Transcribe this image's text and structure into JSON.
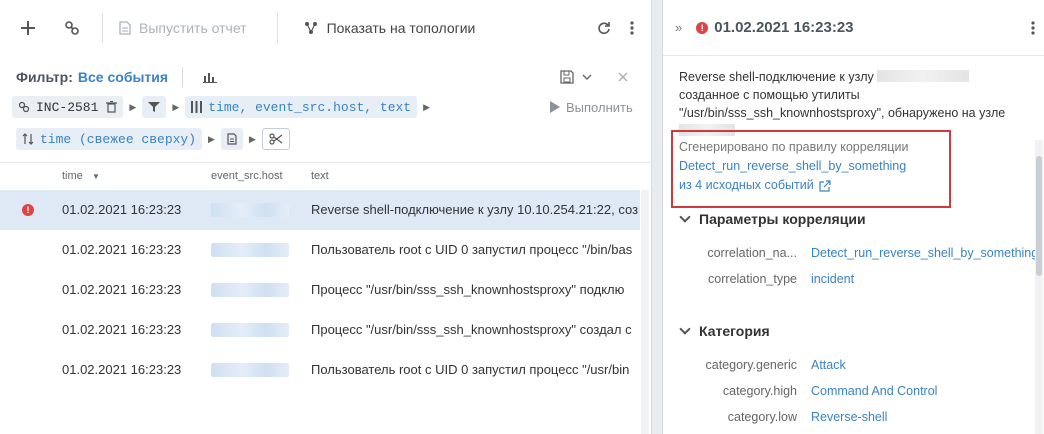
{
  "toolbar": {
    "report_label": "Выпустить отчет",
    "topology_label": "Показать на топологии"
  },
  "filter": {
    "label": "Фильтр:",
    "value": "Все события",
    "incident": "INC-2581",
    "columns": "time, event_src.host, text",
    "sort": "time (свежее сверху)",
    "run_label": "Выполнить"
  },
  "grid": {
    "columns": [
      "time",
      "event_src.host",
      "text"
    ],
    "rows": [
      {
        "time": "01.02.2021 16:23:23",
        "text": "Reverse shell-подключение к узлу 10.10.254.21:22, соз",
        "alert": true,
        "selected": true
      },
      {
        "time": "01.02.2021 16:23:23",
        "text": "Пользователь root с UID 0 запустил процесс \"/bin/bas",
        "alert": false,
        "selected": false
      },
      {
        "time": "01.02.2021 16:23:23",
        "text": "Процесс \"/usr/bin/sss_ssh_knownhostsproxy\" подклю",
        "alert": false,
        "selected": false
      },
      {
        "time": "01.02.2021 16:23:23",
        "text": "Процесс \"/usr/bin/sss_ssh_knownhostsproxy\" создал с",
        "alert": false,
        "selected": false
      },
      {
        "time": "01.02.2021 16:23:23",
        "text": "Пользователь root с UID 0 запустил процесс \"/usr/bin",
        "alert": false,
        "selected": false
      }
    ]
  },
  "details": {
    "title": "01.02.2021 16:23:23",
    "desc_part1": "Reverse shell-подключение к узлу",
    "desc_part2": "созданное с помощью утилиты \"/usr/bin/sss_ssh_knownhostsproxy\", обнаружено на узле",
    "generated_by": "Сгенерировано по правилу корреляции",
    "rule_link": "Detect_run_reverse_shell_by_something",
    "source_events": "из 4 исходных событий",
    "sections": [
      {
        "title": "Параметры корреляции",
        "items": [
          {
            "key": "correlation_na...",
            "value": "Detect_run_reverse_shell_by_something"
          },
          {
            "key": "correlation_type",
            "value": "incident"
          }
        ]
      },
      {
        "title": "Категория",
        "items": [
          {
            "key": "category.generic",
            "value": "Attack"
          },
          {
            "key": "category.high",
            "value": "Command And Control"
          },
          {
            "key": "category.low",
            "value": "Reverse-shell"
          }
        ]
      }
    ]
  },
  "colors": {
    "accent": "#3a83c4",
    "alert": "#e04343",
    "highlight_border": "#d13a3a",
    "selected_row": "#dfe9f6"
  }
}
